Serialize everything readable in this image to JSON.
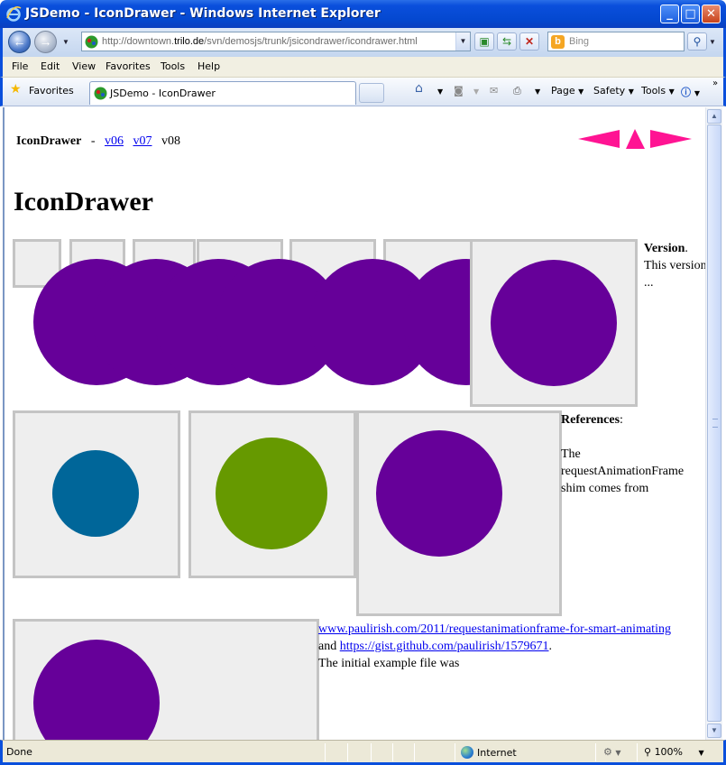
{
  "window": {
    "title": "JSDemo - IconDrawer - Windows Internet Explorer",
    "minimize": "_",
    "maximize": "□",
    "close": "✕"
  },
  "address": {
    "url_prefix": "http://downtown.",
    "url_host": "trilo.de",
    "url_path": "/svn/demosjs/trunk/jsicondrawer/icondrawer.html",
    "search_placeholder": "Bing"
  },
  "menu": [
    "File",
    "Edit",
    "View",
    "Favorites",
    "Tools",
    "Help"
  ],
  "commandbar": {
    "favorites_label": "Favorites",
    "tab_label": "JSDemo - IconDrawer",
    "page_label": "Page",
    "safety_label": "Safety",
    "tools_label": "Tools"
  },
  "page": {
    "brand": "IconDrawer",
    "separator": "-",
    "versions": [
      "v06",
      "v07"
    ],
    "current_version": "v08",
    "heading": "IconDrawer",
    "version_note_bold": "Version",
    "version_note_rest": ". This version ...",
    "references_bold": "References",
    "references_colon": ":",
    "references_text": "The requestAnimationFrame shim comes from",
    "link1": "www.paulirish.com/2011/requestanimationframe-for-smart-animating",
    "and_text": "and",
    "link2": "https://gist.github.com/paulirish/1579671",
    "period": ".",
    "initial_text": "The initial example file was"
  },
  "colors": {
    "purple": "#660099",
    "blue": "#006699",
    "green": "#669900",
    "magenta_arrows": "#ff1493",
    "box_fill": "#eeeeee",
    "box_border": "#c4c4c4"
  },
  "status": {
    "left": "Done",
    "zone": "Internet",
    "zoom": "100%"
  }
}
